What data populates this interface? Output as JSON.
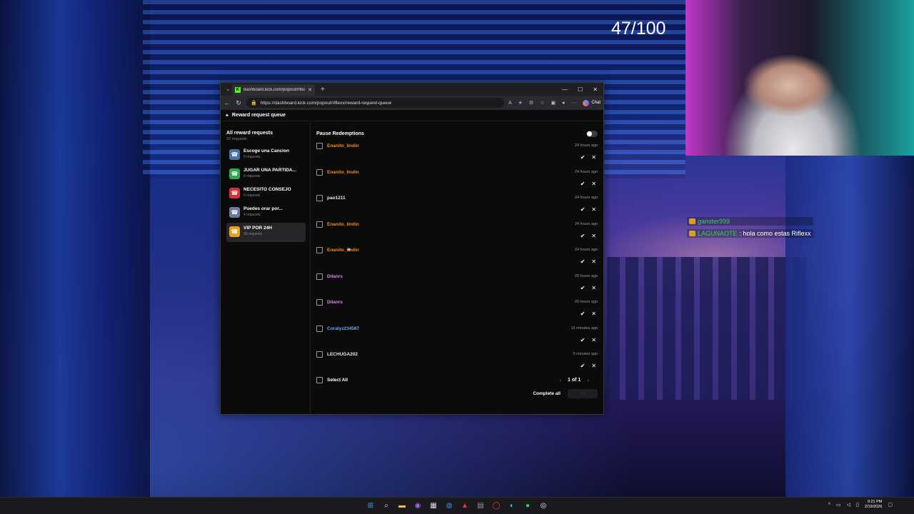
{
  "overlay": {
    "counter": "47/100",
    "chat": [
      {
        "user": "ganster999",
        "message": ""
      },
      {
        "user": "LAGUNAOTE",
        "message": ": hola como estas Riflexx"
      }
    ]
  },
  "browser": {
    "tab_title": "dashboard.kick.com/popout/riflex",
    "url": "https://dashboard.kick.com/popout/riflexx/reward-request-queue",
    "chat_label": "Chat"
  },
  "page": {
    "header": "Reward request queue",
    "sidebar": {
      "all_title": "All reward requests",
      "all_count": "22 requests",
      "items": [
        {
          "name": "Escoge una Cancion",
          "count": "0 requests",
          "color": "#4a6fa5",
          "icon": "☎"
        },
        {
          "name": "JUGAR UNA PARTIDA...",
          "count": "0 requests",
          "color": "#2fa84f",
          "icon": "☎"
        },
        {
          "name": "NECESITO CONSEJO",
          "count": "0 requests",
          "color": "#d6303a",
          "icon": "☎"
        },
        {
          "name": "Puedes orar por...",
          "count": "4 requests",
          "color": "#6a7a9a",
          "icon": "☎"
        },
        {
          "name": "VIP POR 24H",
          "count": "18 requests",
          "color": "#e8a020",
          "icon": "☎"
        }
      ]
    },
    "pause_label": "Pause Redemptions",
    "requests": [
      {
        "user": "Enanito_lindin",
        "time": "24 hours ago",
        "color": "#f08a2c"
      },
      {
        "user": "Enanito_lindin",
        "time": "24 hours ago",
        "color": "#f08a2c"
      },
      {
        "user": "pao1211",
        "time": "24 hours ago",
        "color": "#e8e8e8"
      },
      {
        "user": "Enanito_lindin",
        "time": "24 hours ago",
        "color": "#f08a2c"
      },
      {
        "user": "Enanito_lindin",
        "time": "24 hours ago",
        "color": "#f08a2c"
      },
      {
        "user": "Dilanrs",
        "time": "20 hours ago",
        "color": "#d88ae8"
      },
      {
        "user": "Dilanrs",
        "time": "20 hours ago",
        "color": "#d88ae8"
      },
      {
        "user": "Coralyz234567",
        "time": "16 minutes ago",
        "color": "#6aa8f0"
      },
      {
        "user": "LECHUGA202",
        "time": "5 minutes ago",
        "color": "#e8e8e8"
      }
    ],
    "select_all": "Select All",
    "pagination": "1 of 1",
    "complete_all": "Complete all"
  },
  "taskbar": {
    "time": "9:21 PM",
    "date": "2/19/2026"
  }
}
